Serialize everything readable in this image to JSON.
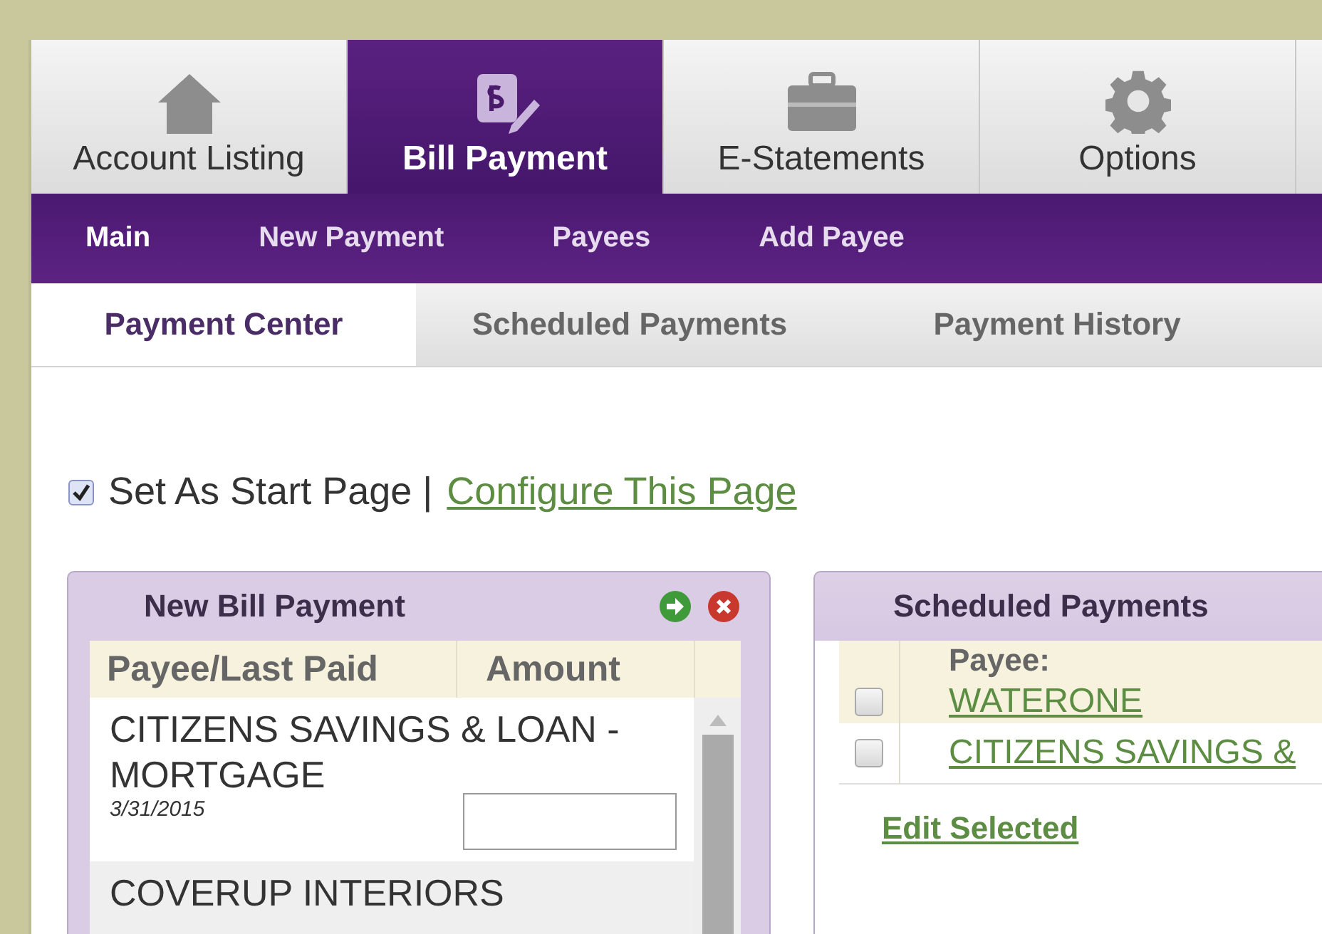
{
  "main_tabs": [
    {
      "label": "Account Listing",
      "selected": false
    },
    {
      "label": "Bill Payment",
      "selected": true
    },
    {
      "label": "E-Statements",
      "selected": false
    },
    {
      "label": "Options",
      "selected": false
    }
  ],
  "sub_nav": [
    {
      "label": "Main",
      "selected": true
    },
    {
      "label": "New Payment",
      "selected": false
    },
    {
      "label": "Payees",
      "selected": false
    },
    {
      "label": "Add Payee",
      "selected": false
    }
  ],
  "section_tabs": [
    {
      "label": "Payment Center",
      "selected": true
    },
    {
      "label": "Scheduled Payments",
      "selected": false
    },
    {
      "label": "Payment History",
      "selected": false
    }
  ],
  "start_page": {
    "label": "Set As Start Page |",
    "checked": true,
    "link": "Configure This Page"
  },
  "new_bill_payment": {
    "title": "New Bill Payment",
    "columns": [
      "Payee/Last Paid",
      "Amount"
    ],
    "rows": [
      {
        "payee": "CITIZENS SAVINGS & LOAN - MORTGAGE",
        "last_paid": "3/31/2015"
      },
      {
        "payee": "COVERUP INTERIORS"
      }
    ]
  },
  "scheduled_payments": {
    "title": "Scheduled Payments",
    "column": "Payee:",
    "rows": [
      {
        "payee": "WATERONE",
        "checked": false
      },
      {
        "payee": "CITIZENS SAVINGS &",
        "checked": false
      }
    ],
    "action": "Edit Selected"
  }
}
